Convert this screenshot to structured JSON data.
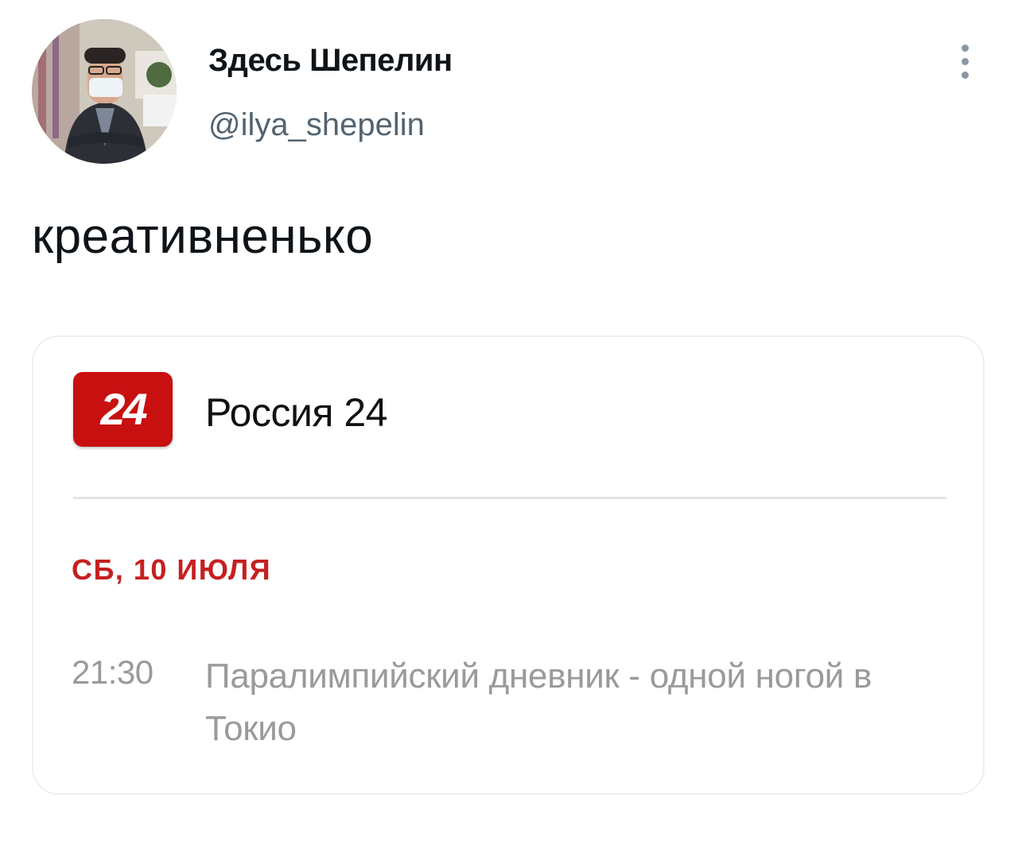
{
  "tweet": {
    "author": {
      "display_name": "Здесь Шепелин",
      "handle": "@ilya_shepelin",
      "avatar_icon": "profile-photo"
    },
    "more_icon": "more-vertical-icon",
    "text": "креативненько"
  },
  "card": {
    "channel": {
      "logo_text": "24",
      "logo_color": "#c81010",
      "name": "Россия 24"
    },
    "date_label": "СБ, 10 ИЮЛЯ",
    "date_color": "#c52020",
    "program": {
      "time": "21:30",
      "title": "Паралимпийский дневник - одной ногой в Токио"
    }
  }
}
